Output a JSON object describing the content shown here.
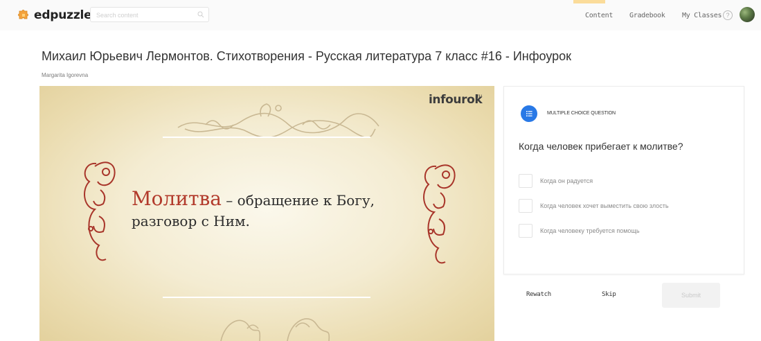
{
  "brand": {
    "name": "edpuzzle",
    "logo_icon": "puzzle-icon"
  },
  "search": {
    "placeholder": "Search content",
    "icon": "search-icon"
  },
  "nav": {
    "items": [
      {
        "label": "Content"
      },
      {
        "label": "Gradebook"
      },
      {
        "label": "My Classes"
      }
    ],
    "help_icon": "question-circle-icon",
    "accent_color": "#fbdc9a"
  },
  "page": {
    "title": "Михаил Юрьевич Лермонтов. Стихотворения - Русская литература 7 класс #16 - Инфоурок",
    "author": "Margarita Igorevna"
  },
  "video": {
    "brand_name": "infourok",
    "brand_suffix": "ru",
    "slide": {
      "term": "Молитва",
      "definition": " – обращение к Богу,",
      "definition_line2": "разговор с Ним."
    },
    "colors": {
      "term": "#b23a2b",
      "ornament": "#c9b893"
    }
  },
  "question": {
    "type_label": "MULTIPLE CHOICE QUESTION",
    "icon": "list-icon",
    "icon_color": "#2979e6",
    "text": "Когда человек прибегает к молитве?",
    "options": [
      {
        "label": "Когда он радуется",
        "checked": false
      },
      {
        "label": "Когда человек хочет выместить свою злость",
        "checked": false
      },
      {
        "label": "Когда человеку требуется помощь",
        "checked": false
      }
    ]
  },
  "actions": {
    "rewatch": "Rewatch",
    "skip": "Skip",
    "submit": "Submit"
  }
}
